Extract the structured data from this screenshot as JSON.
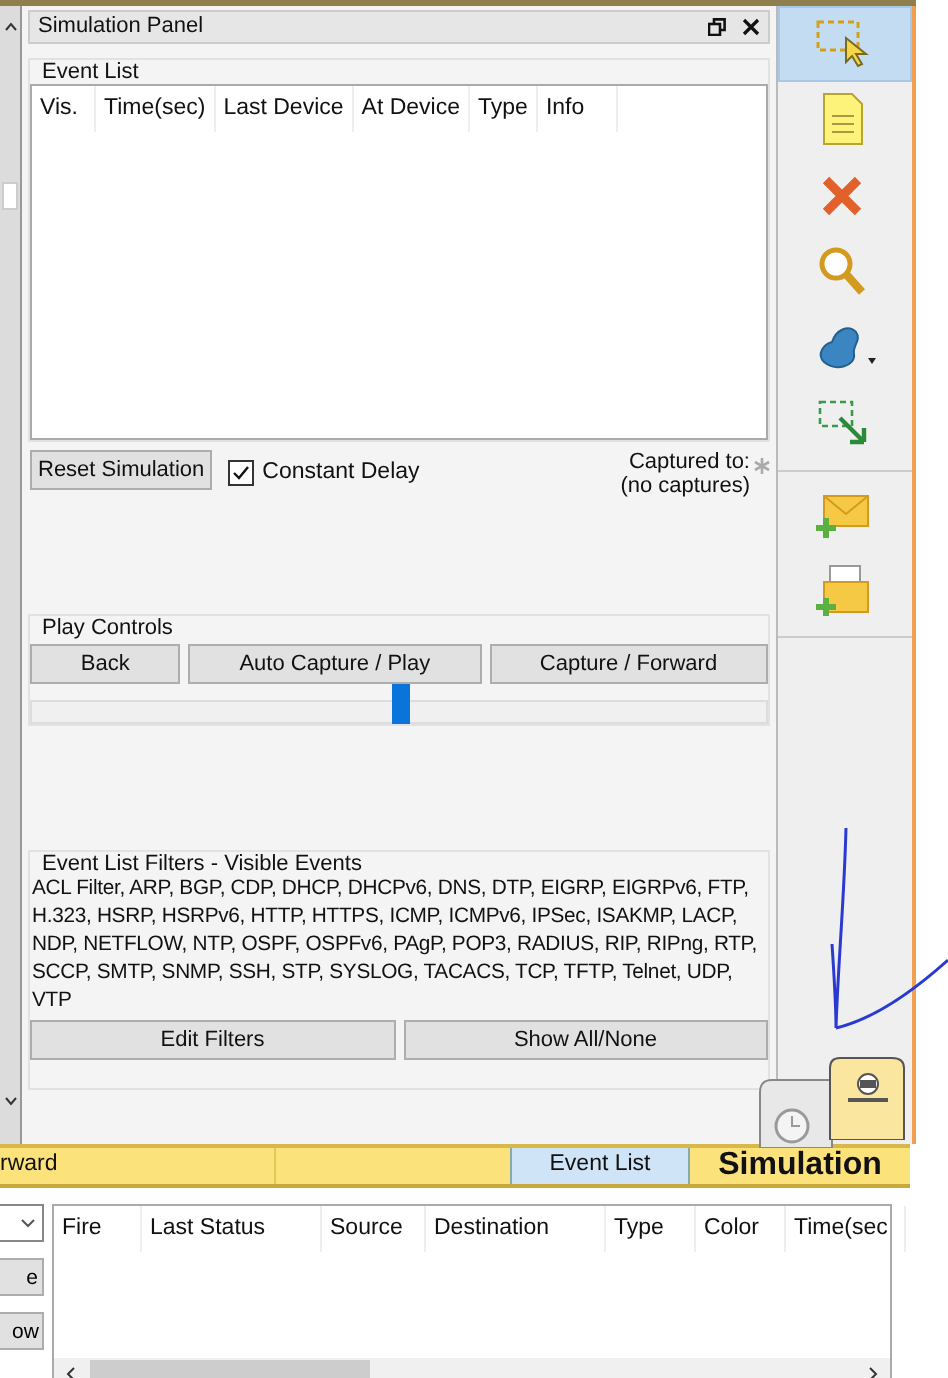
{
  "panel": {
    "title": "Simulation Panel"
  },
  "event_list": {
    "legend": "Event List",
    "columns": [
      "Vis.",
      "Time(sec)",
      "Last Device",
      "At Device",
      "Type",
      "Info"
    ]
  },
  "reset_button": "Reset Simulation",
  "constant_delay": {
    "label": "Constant Delay",
    "checked": true
  },
  "captured": {
    "label": "Captured to:",
    "value": "(no captures)"
  },
  "play_controls": {
    "legend": "Play Controls",
    "buttons": [
      "Back",
      "Auto Capture / Play",
      "Capture / Forward"
    ],
    "slider": {
      "level": 0.5
    }
  },
  "filters": {
    "legend": "Event List Filters - Visible Events",
    "text": "ACL Filter, ARP, BGP, CDP, DHCP, DHCPv6, DNS, DTP, EIGRP, EIGRPv6, FTP, H.323, HSRP, HSRPv6, HTTP, HTTPS, ICMP, ICMPv6, IPSec, ISAKMP, LACP, NDP, NETFLOW, NTP, OSPF, OSPFv6, PAgP, POP3, RADIUS, RIP, RIPng, RTP, SCCP, SMTP, SNMP, SSH, STP, SYSLOG, TACACS, TCP, TFTP, Telnet, UDP, VTP",
    "buttons": [
      "Edit Filters",
      "Show All/None"
    ]
  },
  "toolbar": {
    "items": [
      {
        "kind": "select",
        "selected": true
      },
      {
        "kind": "note",
        "selected": false
      },
      {
        "kind": "delete",
        "selected": false
      },
      {
        "kind": "inspect",
        "selected": false
      },
      {
        "kind": "shape",
        "selected": false
      },
      {
        "kind": "resize",
        "selected": false
      },
      {
        "kind": "pdu",
        "selected": false
      },
      {
        "kind": "complex-pdu",
        "selected": false
      }
    ]
  },
  "bottom_bar": {
    "left_text": "rward",
    "event_list_toggle": {
      "label": "Event List",
      "on": true
    },
    "mode_tab": {
      "label": "Simulation",
      "selected": true
    }
  },
  "left_buttons": [
    "e",
    "ow"
  ],
  "pdu_table": {
    "columns": [
      "Fire",
      "Last Status",
      "Source",
      "Destination",
      "Type",
      "Color",
      "Time(sec"
    ]
  }
}
